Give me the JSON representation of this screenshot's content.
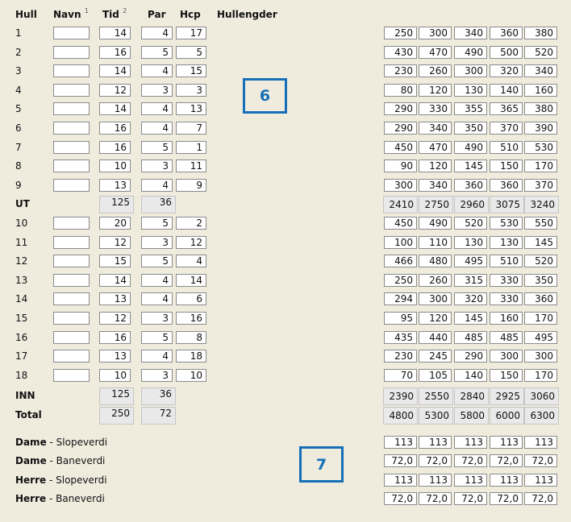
{
  "headers": {
    "hull": "Hull",
    "navn": "Navn",
    "navn_note": "1",
    "tid": "Tid",
    "tid_note": "2",
    "par": "Par",
    "hcp": "Hcp",
    "hullengder": "Hullengder"
  },
  "holes": [
    {
      "hull": "1",
      "navn": "",
      "tid": "14",
      "par": "4",
      "hcp": "17",
      "lengths": [
        "250",
        "300",
        "340",
        "360",
        "380"
      ]
    },
    {
      "hull": "2",
      "navn": "",
      "tid": "16",
      "par": "5",
      "hcp": "5",
      "lengths": [
        "430",
        "470",
        "490",
        "500",
        "520"
      ]
    },
    {
      "hull": "3",
      "navn": "",
      "tid": "14",
      "par": "4",
      "hcp": "15",
      "lengths": [
        "230",
        "260",
        "300",
        "320",
        "340"
      ]
    },
    {
      "hull": "4",
      "navn": "",
      "tid": "12",
      "par": "3",
      "hcp": "3",
      "lengths": [
        "80",
        "120",
        "130",
        "140",
        "160"
      ]
    },
    {
      "hull": "5",
      "navn": "",
      "tid": "14",
      "par": "4",
      "hcp": "13",
      "lengths": [
        "290",
        "330",
        "355",
        "365",
        "380"
      ]
    },
    {
      "hull": "6",
      "navn": "",
      "tid": "16",
      "par": "4",
      "hcp": "7",
      "lengths": [
        "290",
        "340",
        "350",
        "370",
        "390"
      ]
    },
    {
      "hull": "7",
      "navn": "",
      "tid": "16",
      "par": "5",
      "hcp": "1",
      "lengths": [
        "450",
        "470",
        "490",
        "510",
        "530"
      ]
    },
    {
      "hull": "8",
      "navn": "",
      "tid": "10",
      "par": "3",
      "hcp": "11",
      "lengths": [
        "90",
        "120",
        "145",
        "150",
        "170"
      ]
    },
    {
      "hull": "9",
      "navn": "",
      "tid": "13",
      "par": "4",
      "hcp": "9",
      "lengths": [
        "300",
        "340",
        "360",
        "360",
        "370"
      ]
    },
    {
      "hull": "10",
      "navn": "",
      "tid": "20",
      "par": "5",
      "hcp": "2",
      "lengths": [
        "450",
        "490",
        "520",
        "530",
        "550"
      ]
    },
    {
      "hull": "11",
      "navn": "",
      "tid": "12",
      "par": "3",
      "hcp": "12",
      "lengths": [
        "100",
        "110",
        "130",
        "130",
        "145"
      ]
    },
    {
      "hull": "12",
      "navn": "",
      "tid": "15",
      "par": "5",
      "hcp": "4",
      "lengths": [
        "466",
        "480",
        "495",
        "510",
        "520"
      ]
    },
    {
      "hull": "13",
      "navn": "",
      "tid": "14",
      "par": "4",
      "hcp": "14",
      "lengths": [
        "250",
        "260",
        "315",
        "330",
        "350"
      ]
    },
    {
      "hull": "14",
      "navn": "",
      "tid": "13",
      "par": "4",
      "hcp": "6",
      "lengths": [
        "294",
        "300",
        "320",
        "330",
        "360"
      ]
    },
    {
      "hull": "15",
      "navn": "",
      "tid": "12",
      "par": "3",
      "hcp": "16",
      "lengths": [
        "95",
        "120",
        "145",
        "160",
        "170"
      ]
    },
    {
      "hull": "16",
      "navn": "",
      "tid": "16",
      "par": "5",
      "hcp": "8",
      "lengths": [
        "435",
        "440",
        "485",
        "485",
        "495"
      ]
    },
    {
      "hull": "17",
      "navn": "",
      "tid": "13",
      "par": "4",
      "hcp": "18",
      "lengths": [
        "230",
        "245",
        "290",
        "300",
        "300"
      ]
    },
    {
      "hull": "18",
      "navn": "",
      "tid": "10",
      "par": "3",
      "hcp": "10",
      "lengths": [
        "70",
        "105",
        "140",
        "150",
        "170"
      ]
    }
  ],
  "totals": {
    "ut": {
      "label": "UT",
      "tid": "125",
      "par": "36",
      "lengths": [
        "2410",
        "2750",
        "2960",
        "3075",
        "3240"
      ]
    },
    "inn": {
      "label": "INN",
      "tid": "125",
      "par": "36",
      "lengths": [
        "2390",
        "2550",
        "2840",
        "2925",
        "3060"
      ]
    },
    "total": {
      "label": "Total",
      "tid": "250",
      "par": "72",
      "lengths": [
        "4800",
        "5300",
        "5800",
        "6000",
        "6300"
      ]
    }
  },
  "ratings": [
    {
      "gender": "Dame",
      "type": " - Slopeverdi",
      "values": [
        "113",
        "113",
        "113",
        "113",
        "113"
      ]
    },
    {
      "gender": "Dame",
      "type": " - Baneverdi",
      "values": [
        "72,0",
        "72,0",
        "72,0",
        "72,0",
        "72,0"
      ]
    },
    {
      "gender": "Herre",
      "type": " - Slopeverdi",
      "values": [
        "113",
        "113",
        "113",
        "113",
        "113"
      ]
    },
    {
      "gender": "Herre",
      "type": " - Baneverdi",
      "values": [
        "72,0",
        "72,0",
        "72,0",
        "72,0",
        "72,0"
      ]
    }
  ],
  "callouts": {
    "six": "6",
    "seven": "7"
  },
  "colors": {
    "background": "#efecde",
    "callout": "#1670b8",
    "input_border": "#8a8a8a",
    "readonly_fill": "#e9e9e9"
  }
}
